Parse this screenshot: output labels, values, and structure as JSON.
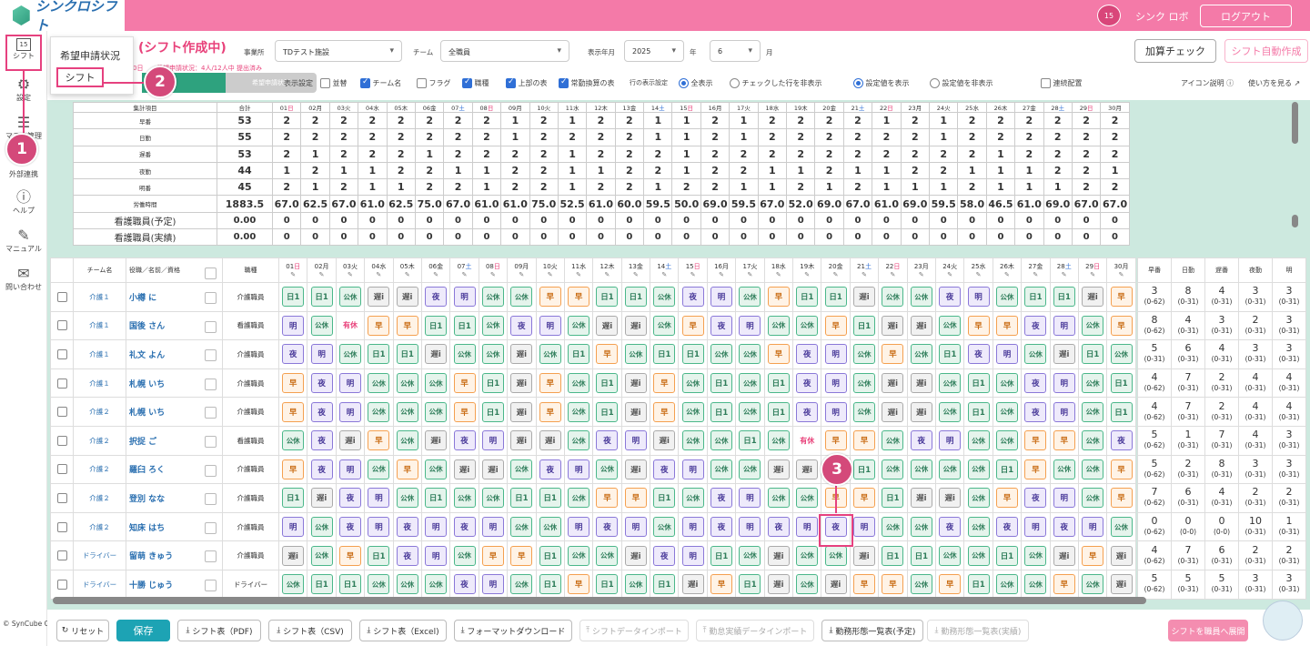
{
  "app": {
    "logo": "シンクロシフト",
    "calendar_day": "15",
    "user": "シンク ロボ",
    "logout": "ログアウト"
  },
  "sidebar": {
    "items": [
      {
        "label": "シフト",
        "icon": "calendar-icon"
      },
      {
        "label": "設定",
        "icon": "gear-icon"
      },
      {
        "label": "マスタ管理",
        "icon": "database-icon"
      },
      {
        "label": "外部連携",
        "icon": "link-icon"
      },
      {
        "label": "ヘルプ",
        "icon": "help-icon"
      },
      {
        "label": "マニュアル",
        "icon": "manual-icon"
      },
      {
        "label": "問い合わせ",
        "icon": "mail-icon"
      }
    ],
    "copyright": "© SynCube Co., Ltd."
  },
  "popup": {
    "items": [
      "希望申請状況",
      "シフト"
    ]
  },
  "badges": [
    "1",
    "2",
    "3"
  ],
  "header": {
    "title": "(シフト作成中)",
    "office_label": "事業所",
    "office": "TDテスト施設",
    "team_label": "チーム",
    "team": "全職員",
    "period_label": "表示年月",
    "year": "2025",
    "year_suffix": "年",
    "month": "6",
    "month_suffix": "月",
    "calc_check": "加算チェック",
    "auto_create": "シフト自動作成",
    "status_prefix": "0日",
    "status": "希望申請状況：4人/12人中 提出済み",
    "tab_kibou": "希望申請状況"
  },
  "options": {
    "display_label": "表示設定",
    "row_display_label": "行の表示設定",
    "checks": [
      {
        "label": "並替",
        "on": false
      },
      {
        "label": "チーム名",
        "on": true
      },
      {
        "label": "フラグ",
        "on": false
      },
      {
        "label": "職種",
        "on": true
      },
      {
        "label": "上部の表",
        "on": true
      },
      {
        "label": "常勤換算の表",
        "on": true
      }
    ],
    "radios": [
      {
        "label": "全表示",
        "on": true
      },
      {
        "label": "チェックした行を非表示",
        "on": false
      },
      {
        "label": "設定値を表示",
        "on": true
      },
      {
        "label": "設定値を非表示",
        "on": false
      }
    ],
    "consecutive": "連続配置",
    "icon_help": "アイコン説明",
    "howto": "使い方を見る"
  },
  "days": [
    {
      "d": "01",
      "w": "日"
    },
    {
      "d": "02",
      "w": "月"
    },
    {
      "d": "03",
      "w": "火"
    },
    {
      "d": "04",
      "w": "水"
    },
    {
      "d": "05",
      "w": "木"
    },
    {
      "d": "06",
      "w": "金"
    },
    {
      "d": "07",
      "w": "土"
    },
    {
      "d": "08",
      "w": "日"
    },
    {
      "d": "09",
      "w": "月"
    },
    {
      "d": "10",
      "w": "火"
    },
    {
      "d": "11",
      "w": "水"
    },
    {
      "d": "12",
      "w": "木"
    },
    {
      "d": "13",
      "w": "金"
    },
    {
      "d": "14",
      "w": "土"
    },
    {
      "d": "15",
      "w": "日"
    },
    {
      "d": "16",
      "w": "月"
    },
    {
      "d": "17",
      "w": "火"
    },
    {
      "d": "18",
      "w": "水"
    },
    {
      "d": "19",
      "w": "木"
    },
    {
      "d": "20",
      "w": "金"
    },
    {
      "d": "21",
      "w": "土"
    },
    {
      "d": "22",
      "w": "日"
    },
    {
      "d": "23",
      "w": "月"
    },
    {
      "d": "24",
      "w": "火"
    },
    {
      "d": "25",
      "w": "水"
    },
    {
      "d": "26",
      "w": "木"
    },
    {
      "d": "27",
      "w": "金"
    },
    {
      "d": "28",
      "w": "土"
    },
    {
      "d": "29",
      "w": "日"
    },
    {
      "d": "30",
      "w": "月"
    }
  ],
  "summary": {
    "header": "集計項目",
    "total_header": "合計",
    "rows": [
      {
        "label": "早番",
        "total": "53",
        "v": [
          "2",
          "2",
          "2",
          "2",
          "2",
          "2",
          "2",
          "2",
          "1",
          "2",
          "1",
          "2",
          "2",
          "1",
          "1",
          "2",
          "1",
          "2",
          "2",
          "2",
          "2",
          "1",
          "2",
          "1",
          "2",
          "2",
          "2",
          "2",
          "2",
          "2"
        ]
      },
      {
        "label": "日勤",
        "total": "55",
        "v": [
          "2",
          "2",
          "2",
          "2",
          "2",
          "2",
          "2",
          "2",
          "1",
          "2",
          "2",
          "2",
          "2",
          "1",
          "1",
          "2",
          "1",
          "2",
          "2",
          "2",
          "2",
          "2",
          "2",
          "1",
          "2",
          "2",
          "2",
          "2",
          "2",
          "2"
        ]
      },
      {
        "label": "遅番",
        "total": "53",
        "v": [
          "2",
          "1",
          "2",
          "2",
          "2",
          "1",
          "2",
          "2",
          "2",
          "2",
          "1",
          "2",
          "2",
          "2",
          "1",
          "2",
          "2",
          "2",
          "2",
          "2",
          "2",
          "2",
          "2",
          "2",
          "2",
          "1",
          "2",
          "2",
          "2",
          "2"
        ]
      },
      {
        "label": "夜勤",
        "total": "44",
        "v": [
          "1",
          "2",
          "1",
          "1",
          "2",
          "2",
          "1",
          "1",
          "2",
          "2",
          "1",
          "1",
          "2",
          "2",
          "1",
          "2",
          "2",
          "1",
          "1",
          "2",
          "1",
          "1",
          "2",
          "2",
          "1",
          "1",
          "1",
          "2",
          "2",
          "1"
        ]
      },
      {
        "label": "明番",
        "total": "45",
        "v": [
          "2",
          "1",
          "2",
          "1",
          "1",
          "2",
          "2",
          "1",
          "2",
          "2",
          "1",
          "2",
          "2",
          "1",
          "2",
          "2",
          "1",
          "1",
          "2",
          "1",
          "2",
          "1",
          "1",
          "1",
          "2",
          "1",
          "1",
          "1",
          "2",
          "2"
        ]
      },
      {
        "label": "労働時間",
        "total": "1883.5",
        "v": [
          "67.0",
          "62.5",
          "67.0",
          "61.0",
          "62.5",
          "75.0",
          "67.0",
          "61.0",
          "61.0",
          "75.0",
          "52.5",
          "61.0",
          "60.0",
          "59.5",
          "50.0",
          "69.0",
          "59.5",
          "67.0",
          "52.0",
          "69.0",
          "67.0",
          "61.0",
          "69.0",
          "59.5",
          "58.0",
          "46.5",
          "61.0",
          "69.0",
          "67.0",
          "67.0"
        ]
      },
      {
        "label": "看護職員(予定)",
        "total": "0.00",
        "v": [
          "0",
          "0",
          "0",
          "0",
          "0",
          "0",
          "0",
          "0",
          "0",
          "0",
          "0",
          "0",
          "0",
          "0",
          "0",
          "0",
          "0",
          "0",
          "0",
          "0",
          "0",
          "0",
          "0",
          "0",
          "0",
          "0",
          "0",
          "0",
          "0",
          "0"
        ]
      },
      {
        "label": "看護職員(実績)",
        "total": "0.00",
        "v": [
          "0",
          "0",
          "0",
          "0",
          "0",
          "0",
          "0",
          "0",
          "0",
          "0",
          "0",
          "0",
          "0",
          "0",
          "0",
          "0",
          "0",
          "0",
          "0",
          "0",
          "0",
          "0",
          "0",
          "0",
          "0",
          "0",
          "0",
          "0",
          "0",
          "0"
        ]
      }
    ]
  },
  "staff_header": {
    "team": "チーム名",
    "name": "役職／名前／資格",
    "role": "職種"
  },
  "staff": [
    {
      "team": "介護１",
      "name": "小樽 に",
      "role": "介護職員",
      "s": [
        "日1",
        "日1",
        "公休",
        "遅i",
        "遅i",
        "夜",
        "明",
        "公休",
        "公休",
        "早",
        "早",
        "日1",
        "日1",
        "公休",
        "夜",
        "明",
        "公休",
        "早",
        "日1",
        "日1",
        "遅i",
        "公休",
        "公休",
        "夜",
        "明",
        "公休",
        "日1",
        "日1",
        "遅i",
        "早"
      ]
    },
    {
      "team": "介護１",
      "name": "国後 さん",
      "role": "看護職員",
      "s": [
        "明",
        "公休",
        "有休",
        "早",
        "早",
        "日1",
        "日1",
        "公休",
        "夜",
        "明",
        "公休",
        "遅i",
        "遅i",
        "公休",
        "早",
        "夜",
        "明",
        "公休",
        "公休",
        "早",
        "日1",
        "遅i",
        "遅i",
        "公休",
        "早",
        "早",
        "夜",
        "明",
        "公休",
        "早"
      ]
    },
    {
      "team": "介護１",
      "name": "礼文 よん",
      "role": "介護職員",
      "s": [
        "夜",
        "明",
        "公休",
        "日1",
        "日1",
        "遅i",
        "公休",
        "公休",
        "遅i",
        "公休",
        "日1",
        "早",
        "公休",
        "日1",
        "日1",
        "公休",
        "公休",
        "早",
        "夜",
        "明",
        "公休",
        "早",
        "公休",
        "日1",
        "夜",
        "明",
        "公休",
        "遅i",
        "日1",
        "公休"
      ]
    },
    {
      "team": "介護１",
      "name": "札幌 いち",
      "role": "介護職員",
      "s": [
        "早",
        "夜",
        "明",
        "公休",
        "公休",
        "公休",
        "早",
        "日1",
        "遅i",
        "早",
        "公休",
        "日1",
        "遅i",
        "早",
        "公休",
        "日1",
        "公休",
        "日1",
        "夜",
        "明",
        "公休",
        "遅i",
        "遅i",
        "公休",
        "日1",
        "公休",
        "夜",
        "明",
        "公休",
        "日1"
      ]
    },
    {
      "team": "介護２",
      "name": "札幌 いち",
      "role": "介護職員",
      "s": [
        "早",
        "夜",
        "明",
        "公休",
        "公休",
        "公休",
        "早",
        "日1",
        "遅i",
        "早",
        "公休",
        "日1",
        "遅i",
        "早",
        "公休",
        "日1",
        "公休",
        "日1",
        "夜",
        "明",
        "公休",
        "遅i",
        "遅i",
        "公休",
        "日1",
        "公休",
        "夜",
        "明",
        "公休",
        "日1"
      ]
    },
    {
      "team": "介護２",
      "name": "択捉 ご",
      "role": "看護職員",
      "s": [
        "公休",
        "夜",
        "遅i",
        "早",
        "公休",
        "遅i",
        "夜",
        "明",
        "遅i",
        "遅i",
        "公休",
        "夜",
        "明",
        "遅i",
        "公休",
        "公休",
        "日1",
        "公休",
        "有休",
        "早",
        "早",
        "公休",
        "夜",
        "明",
        "公休",
        "公休",
        "早",
        "早",
        "公休",
        "夜"
      ]
    },
    {
      "team": "介護２",
      "name": "羅臼 ろく",
      "role": "介護職員",
      "s": [
        "早",
        "夜",
        "明",
        "公休",
        "早",
        "公休",
        "遅i",
        "遅i",
        "公休",
        "夜",
        "明",
        "公休",
        "遅i",
        "夜",
        "明",
        "公休",
        "公休",
        "遅i",
        "遅i",
        "公休",
        "日1",
        "公休",
        "公休",
        "公休",
        "公休",
        "日1",
        "早",
        "公休",
        "公休",
        "早"
      ]
    },
    {
      "team": "介護２",
      "name": "登別 なな",
      "role": "介護職員",
      "s": [
        "日1",
        "遅i",
        "夜",
        "明",
        "公休",
        "日1",
        "公休",
        "公休",
        "日1",
        "日1",
        "公休",
        "早",
        "早",
        "日1",
        "公休",
        "夜",
        "明",
        "公休",
        "公休",
        "早",
        "早",
        "日1",
        "遅i",
        "遅i",
        "公休",
        "早",
        "夜",
        "明",
        "公休",
        "早"
      ]
    },
    {
      "team": "介護２",
      "name": "知床 はち",
      "role": "介護職員",
      "s": [
        "明",
        "公休",
        "夜",
        "明",
        "夜",
        "明",
        "夜",
        "明",
        "公休",
        "公休",
        "明",
        "夜",
        "明",
        "公休",
        "明",
        "夜",
        "明",
        "夜",
        "明",
        "夜",
        "明",
        "公休",
        "公休",
        "夜",
        "公休",
        "夜",
        "明",
        "夜",
        "明",
        "公休"
      ]
    },
    {
      "team": "ドライバー",
      "name": "留萌 きゅう",
      "role": "介護職員",
      "s": [
        "遅i",
        "公休",
        "早",
        "日1",
        "夜",
        "明",
        "公休",
        "早",
        "早",
        "日1",
        "公休",
        "公休",
        "遅i",
        "夜",
        "明",
        "日1",
        "公休",
        "遅i",
        "公休",
        "公休",
        "遅i",
        "日1",
        "日1",
        "公休",
        "公休",
        "日1",
        "公休",
        "遅i",
        "早",
        "遅i"
      ]
    },
    {
      "team": "ドライバー",
      "name": "十勝 じゅう",
      "role": "ドライバー",
      "s": [
        "公休",
        "日1",
        "日1",
        "公休",
        "公休",
        "公休",
        "夜",
        "明",
        "公休",
        "日1",
        "早",
        "日1",
        "公休",
        "日1",
        "遅i",
        "早",
        "日1",
        "遅i",
        "公休",
        "遅i",
        "早",
        "早",
        "公休",
        "早",
        "日1",
        "公休",
        "公休",
        "早",
        "公休",
        "遅i"
      ]
    }
  ],
  "stats_header": [
    "早番",
    "日勤",
    "遅番",
    "夜勤",
    "明"
  ],
  "stats": [
    [
      [
        "3",
        "(0-62)"
      ],
      [
        "8",
        "(0-31)"
      ],
      [
        "4",
        "(0-31)"
      ],
      [
        "3",
        "(0-31)"
      ],
      [
        "3",
        "(0-31)"
      ]
    ],
    [
      [
        "8",
        "(0-62)"
      ],
      [
        "4",
        "(0-31)"
      ],
      [
        "3",
        "(0-31)"
      ],
      [
        "2",
        "(0-31)"
      ],
      [
        "3",
        "(0-31)"
      ]
    ],
    [
      [
        "5",
        "(0-31)"
      ],
      [
        "6",
        "(0-31)"
      ],
      [
        "4",
        "(0-31)"
      ],
      [
        "3",
        "(0-31)"
      ],
      [
        "3",
        "(0-31)"
      ]
    ],
    [
      [
        "4",
        "(0-62)"
      ],
      [
        "7",
        "(0-31)"
      ],
      [
        "2",
        "(0-31)"
      ],
      [
        "4",
        "(0-31)"
      ],
      [
        "4",
        "(0-31)"
      ]
    ],
    [
      [
        "4",
        "(0-62)"
      ],
      [
        "7",
        "(0-31)"
      ],
      [
        "2",
        "(0-31)"
      ],
      [
        "4",
        "(0-31)"
      ],
      [
        "4",
        "(0-31)"
      ]
    ],
    [
      [
        "5",
        "(0-62)"
      ],
      [
        "1",
        "(0-31)"
      ],
      [
        "7",
        "(0-31)"
      ],
      [
        "4",
        "(0-31)"
      ],
      [
        "3",
        "(0-31)"
      ]
    ],
    [
      [
        "5",
        "(0-62)"
      ],
      [
        "2",
        "(0-31)"
      ],
      [
        "8",
        "(0-31)"
      ],
      [
        "3",
        "(0-31)"
      ],
      [
        "3",
        "(0-31)"
      ]
    ],
    [
      [
        "7",
        "(0-62)"
      ],
      [
        "6",
        "(0-31)"
      ],
      [
        "4",
        "(0-31)"
      ],
      [
        "2",
        "(0-31)"
      ],
      [
        "2",
        "(0-31)"
      ]
    ],
    [
      [
        "0",
        "(0-62)"
      ],
      [
        "0",
        "(0-0)"
      ],
      [
        "0",
        "(0-0)"
      ],
      [
        "10",
        "(0-31)"
      ],
      [
        "1",
        "(0-31)"
      ]
    ],
    [
      [
        "4",
        "(0-62)"
      ],
      [
        "7",
        "(0-31)"
      ],
      [
        "6",
        "(0-31)"
      ],
      [
        "2",
        "(0-31)"
      ],
      [
        "2",
        "(0-31)"
      ]
    ],
    [
      [
        "5",
        "(0-62)"
      ],
      [
        "5",
        "(0-31)"
      ],
      [
        "5",
        "(0-31)"
      ],
      [
        "3",
        "(0-31)"
      ],
      [
        "3",
        "(0-31)"
      ]
    ]
  ],
  "footer": {
    "buttons": [
      "リセット",
      "保存",
      "シフト表（PDF)",
      "シフト表（CSV)",
      "シフト表（Excel)",
      "フォーマットダウンロード",
      "シフトデータインポート",
      "勤怠実績データインポート",
      "勤務形態一覧表(予定)",
      "勤務形態一覧表(実績)",
      "シフトを職員へ展開"
    ]
  }
}
